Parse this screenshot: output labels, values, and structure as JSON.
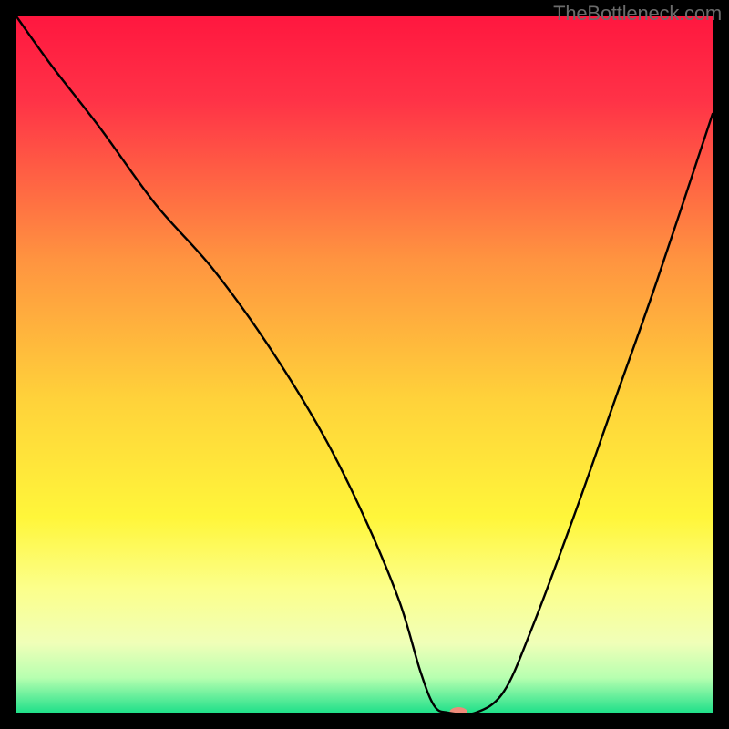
{
  "watermark": "TheBottleneck.com",
  "chart_data": {
    "type": "line",
    "title": "",
    "xlabel": "",
    "ylabel": "",
    "xlim": [
      0,
      100
    ],
    "ylim": [
      0,
      100
    ],
    "grid": false,
    "legend": false,
    "background": {
      "type": "vertical-gradient",
      "stops": [
        {
          "pos": 0.0,
          "color": "#ff173f"
        },
        {
          "pos": 0.12,
          "color": "#ff3247"
        },
        {
          "pos": 0.35,
          "color": "#ff9440"
        },
        {
          "pos": 0.55,
          "color": "#ffd23a"
        },
        {
          "pos": 0.72,
          "color": "#fff63a"
        },
        {
          "pos": 0.82,
          "color": "#fcff8a"
        },
        {
          "pos": 0.9,
          "color": "#f0ffb8"
        },
        {
          "pos": 0.95,
          "color": "#b7ffb0"
        },
        {
          "pos": 1.0,
          "color": "#20e08a"
        }
      ]
    },
    "series": [
      {
        "name": "bottleneck-curve",
        "color": "#000000",
        "width": 2.4,
        "x": [
          0,
          5,
          12,
          20,
          28,
          36,
          44,
          50,
          55,
          58,
          60,
          62,
          66,
          70,
          74,
          80,
          86,
          92,
          100
        ],
        "y": [
          100,
          93,
          84,
          73,
          64,
          53,
          40,
          28,
          16,
          6,
          1,
          0,
          0,
          3,
          12,
          28,
          45,
          62,
          86
        ]
      }
    ],
    "marker": {
      "name": "optimal-point",
      "x": 63.5,
      "y": 0,
      "color": "#ef8a7a",
      "rx": 10,
      "ry": 6
    }
  }
}
